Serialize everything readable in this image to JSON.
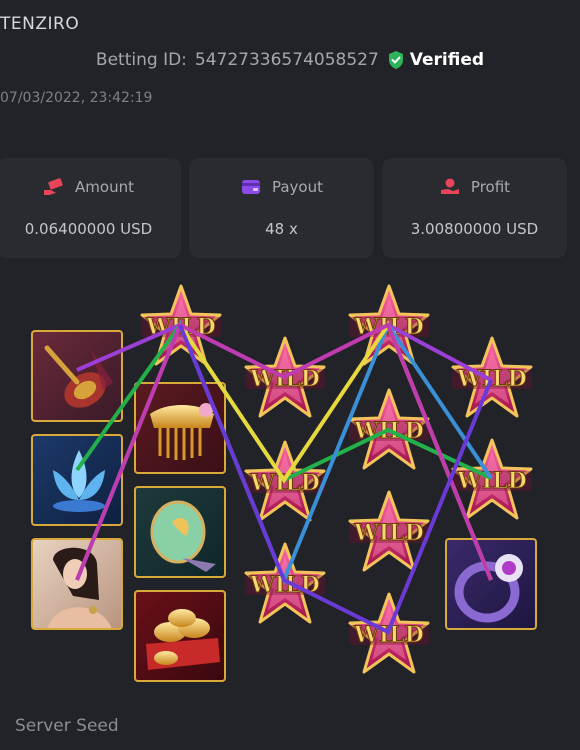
{
  "header": {
    "title": "TENZIRO",
    "betting_id_label": "Betting ID:",
    "betting_id": "54727336574058527",
    "verified_label": "Verified",
    "timestamp": "07/03/2022, 23:42:19"
  },
  "stats": [
    {
      "label": "Amount",
      "value": "0.06400000 USD",
      "icon": "money-hand-icon"
    },
    {
      "label": "Payout",
      "value": "48 x",
      "icon": "wallet-icon"
    },
    {
      "label": "Profit",
      "value": "3.00800000 USD",
      "icon": "coin-hand-icon"
    }
  ],
  "slot": {
    "wild_text": "WILD",
    "symbols": {
      "pipa": "pipa-lute",
      "lotus": "blue-lotus",
      "lady": "lady-portrait",
      "comb": "golden-comb",
      "fan": "jade-fan",
      "gold": "gold-ingots",
      "ring": "amethyst-ring"
    },
    "line_colors": [
      "#9b3fd6",
      "#23b04b",
      "#3a8fd6",
      "#e8d840",
      "#c03ab0",
      "#6a3ad6"
    ]
  },
  "footer": {
    "server_seed_label": "Server Seed"
  },
  "colors": {
    "background": "#222328",
    "card": "#2a2b31",
    "verified_green": "#2fb35a",
    "tile_border": "#d9a93a",
    "wild_star": "#d6286e"
  }
}
